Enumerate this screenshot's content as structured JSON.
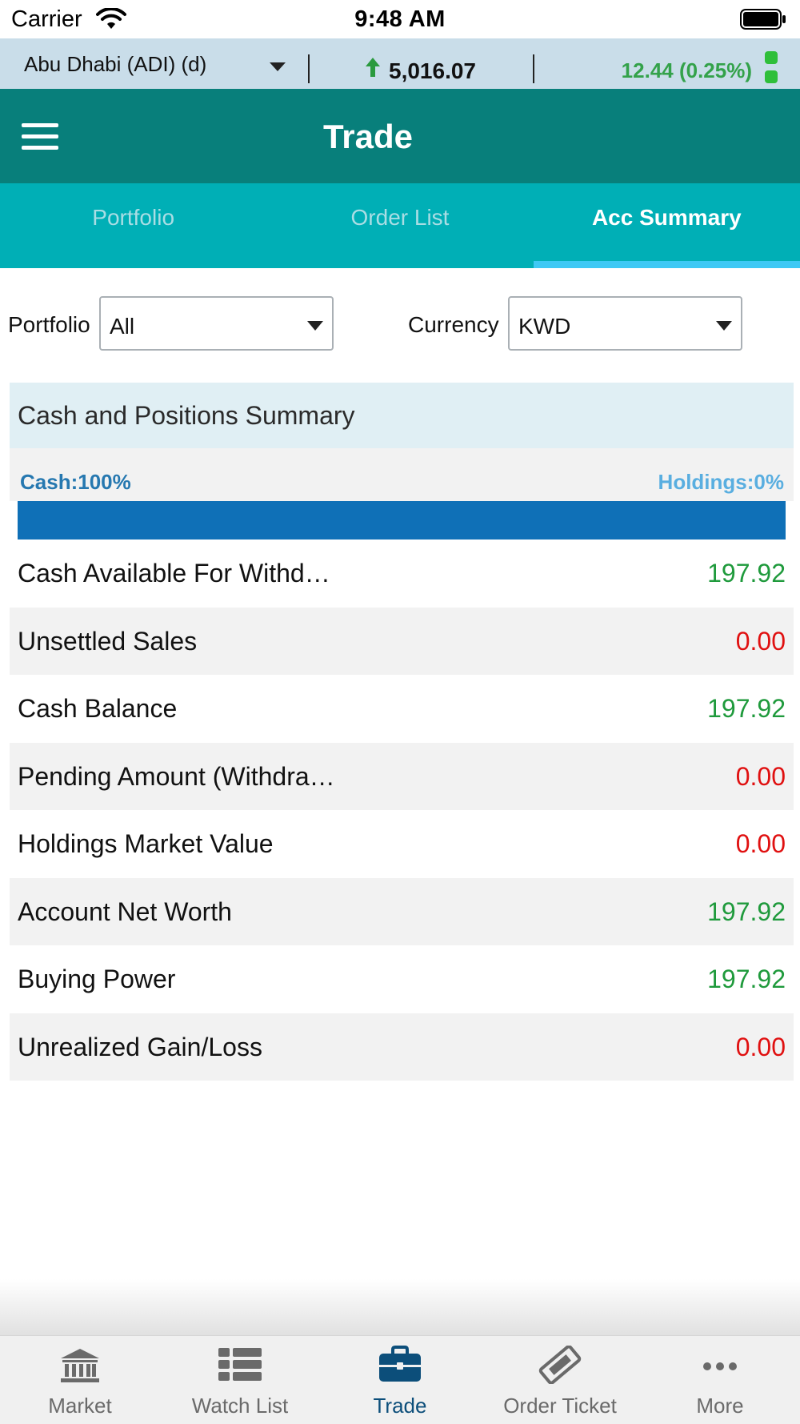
{
  "status_bar": {
    "carrier": "Carrier",
    "time": "9:48 AM"
  },
  "ticker": {
    "exchange": "Abu Dhabi (ADI) (d)",
    "index_value": "5,016.07",
    "change": "12.44 (0.25%)",
    "direction": "up"
  },
  "header": {
    "title": "Trade"
  },
  "tabs": [
    {
      "label": "Portfolio",
      "active": false
    },
    {
      "label": "Order List",
      "active": false
    },
    {
      "label": "Acc Summary",
      "active": true
    }
  ],
  "filters": {
    "portfolio_label": "Portfolio",
    "portfolio_value": "All",
    "currency_label": "Currency",
    "currency_value": "KWD"
  },
  "summary": {
    "title": "Cash and Positions Summary",
    "cash_label": "Cash:100%",
    "holdings_label": "Holdings:0%",
    "cash_fraction": 1.0,
    "rows": [
      {
        "label": "Cash Available For Withd…",
        "value": "197.92",
        "status": "positive"
      },
      {
        "label": "Unsettled Sales",
        "value": "0.00",
        "status": "negative"
      },
      {
        "label": "Cash Balance",
        "value": "197.92",
        "status": "positive"
      },
      {
        "label": "Pending Amount (Withdra…",
        "value": "0.00",
        "status": "negative"
      },
      {
        "label": "Holdings Market Value",
        "value": "0.00",
        "status": "negative"
      },
      {
        "label": "Account Net Worth",
        "value": "197.92",
        "status": "positive"
      },
      {
        "label": "Buying Power",
        "value": "197.92",
        "status": "positive"
      },
      {
        "label": "Unrealized Gain/Loss",
        "value": "0.00",
        "status": "negative"
      }
    ]
  },
  "tabbar": {
    "items": [
      {
        "label": "Market",
        "icon": "bank-icon",
        "active": false
      },
      {
        "label": "Watch List",
        "icon": "list-icon",
        "active": false
      },
      {
        "label": "Trade",
        "icon": "briefcase-icon",
        "active": true
      },
      {
        "label": "Order Ticket",
        "icon": "ticket-icon",
        "active": false
      },
      {
        "label": "More",
        "icon": "more-icon",
        "active": false
      }
    ]
  },
  "colors": {
    "header": "#087f7b",
    "tabs": "#00afb6",
    "positive": "#1f9a3c",
    "negative": "#e01010",
    "cash_bar": "#0f70b7"
  }
}
